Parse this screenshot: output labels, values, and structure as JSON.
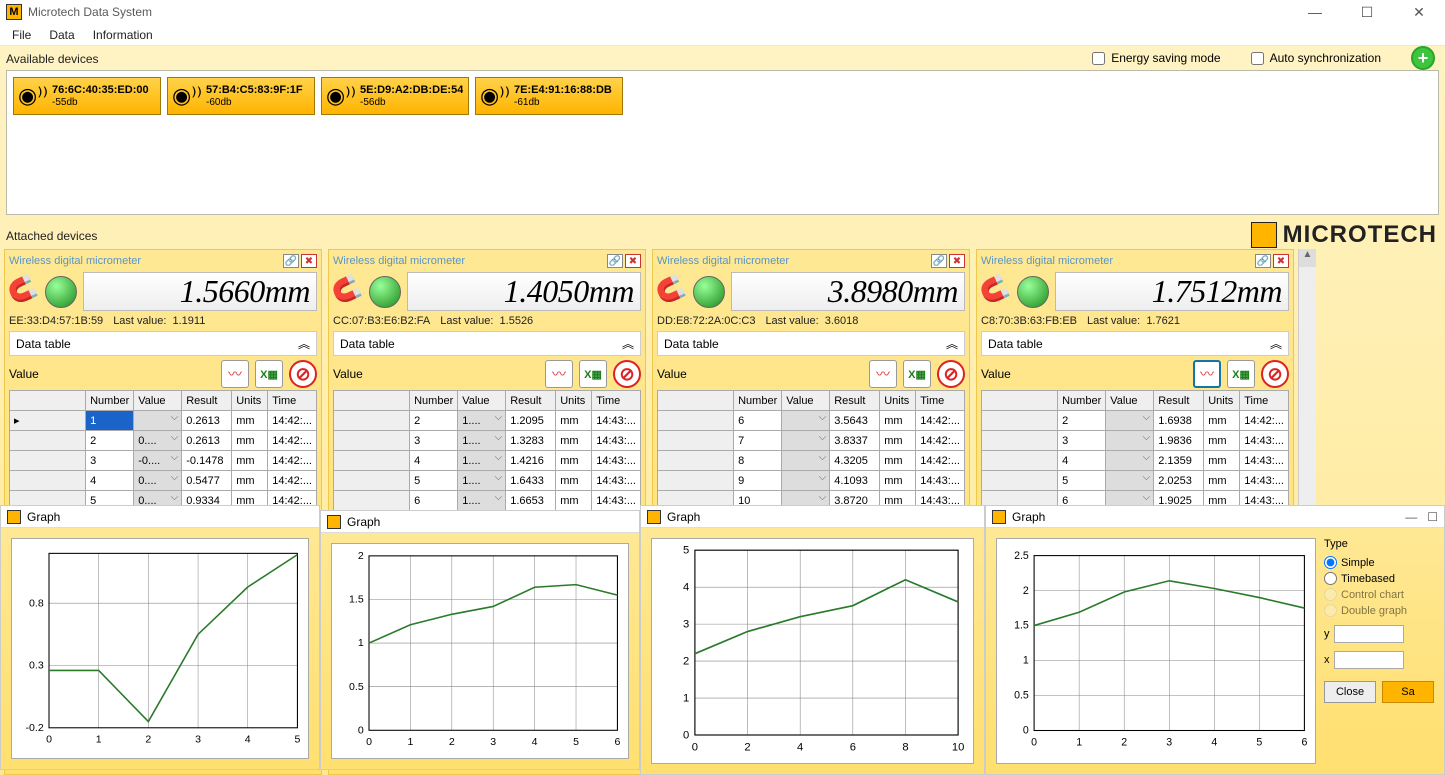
{
  "window": {
    "title": "Microtech Data System"
  },
  "menu": {
    "file": "File",
    "data": "Data",
    "info": "Information"
  },
  "labels": {
    "available": "Available devices",
    "attached": "Attached devices",
    "energy": "Energy saving mode",
    "autosync": "Auto synchronization",
    "brand": "MICROTECH",
    "data_table": "Data table",
    "value": "Value",
    "graph": "Graph",
    "type": "Type",
    "simple": "Simple",
    "timebased": "Timebased",
    "control": "Control chart",
    "double": "Double graph",
    "y": "y",
    "x": "x",
    "close": "Close",
    "save": "Save",
    "last_value": "Last value:"
  },
  "available_devices": [
    {
      "mac": "76:6C:40:35:ED:00",
      "db": "-55db"
    },
    {
      "mac": "57:B4:C5:83:9F:1F",
      "db": "-60db"
    },
    {
      "mac": "5E:D9:A2:DB:DE:54",
      "db": "-56db"
    },
    {
      "mac": "7E:E4:91:16:88:DB",
      "db": "-61db"
    }
  ],
  "columns": {
    "number": "Number",
    "value": "Value",
    "result": "Result",
    "units": "Units",
    "time": "Time"
  },
  "panels": [
    {
      "title": "Wireless digital micrometer",
      "reading": "1.5660mm",
      "id": "EE:33:D4:57:1B:59",
      "last": "1.1911",
      "highlight": 0,
      "rows": [
        {
          "n": "1",
          "v": "",
          "r": "0.2613",
          "u": "mm",
          "t": "14:42:..."
        },
        {
          "n": "2",
          "v": "0....",
          "r": "0.2613",
          "u": "mm",
          "t": "14:42:..."
        },
        {
          "n": "3",
          "v": "-0....",
          "r": "-0.1478",
          "u": "mm",
          "t": "14:42:..."
        },
        {
          "n": "4",
          "v": "0....",
          "r": "0.5477",
          "u": "mm",
          "t": "14:42:..."
        },
        {
          "n": "5",
          "v": "0....",
          "r": "0.9334",
          "u": "mm",
          "t": "14:42:..."
        }
      ]
    },
    {
      "title": "Wireless digital micrometer",
      "reading": "1.4050mm",
      "id": "CC:07:B3:E6:B2:FA",
      "last": "1.5526",
      "rows": [
        {
          "n": "2",
          "v": "1....",
          "r": "1.2095",
          "u": "mm",
          "t": "14:43:..."
        },
        {
          "n": "3",
          "v": "1....",
          "r": "1.3283",
          "u": "mm",
          "t": "14:43:..."
        },
        {
          "n": "4",
          "v": "1....",
          "r": "1.4216",
          "u": "mm",
          "t": "14:43:..."
        },
        {
          "n": "5",
          "v": "1....",
          "r": "1.6433",
          "u": "mm",
          "t": "14:43:..."
        },
        {
          "n": "6",
          "v": "1....",
          "r": "1.6653",
          "u": "mm",
          "t": "14:43:..."
        }
      ]
    },
    {
      "title": "Wireless digital micrometer",
      "reading": "3.8980mm",
      "id": "DD:E8:72:2A:0C:C3",
      "last": "3.6018",
      "rows": [
        {
          "n": "6",
          "v": "",
          "r": "3.5643",
          "u": "mm",
          "t": "14:42:..."
        },
        {
          "n": "7",
          "v": "",
          "r": "3.8337",
          "u": "mm",
          "t": "14:42:..."
        },
        {
          "n": "8",
          "v": "",
          "r": "4.3205",
          "u": "mm",
          "t": "14:42:..."
        },
        {
          "n": "9",
          "v": "",
          "r": "4.1093",
          "u": "mm",
          "t": "14:43:..."
        },
        {
          "n": "10",
          "v": "",
          "r": "3.8720",
          "u": "mm",
          "t": "14:43:..."
        }
      ]
    },
    {
      "title": "Wireless digital micrometer",
      "reading": "1.7512mm",
      "id": "C8:70:3B:63:FB:EB",
      "last": "1.7621",
      "rows": [
        {
          "n": "2",
          "v": "",
          "r": "1.6938",
          "u": "mm",
          "t": "14:42:..."
        },
        {
          "n": "3",
          "v": "",
          "r": "1.9836",
          "u": "mm",
          "t": "14:43:..."
        },
        {
          "n": "4",
          "v": "",
          "r": "2.1359",
          "u": "mm",
          "t": "14:43:..."
        },
        {
          "n": "5",
          "v": "",
          "r": "2.0253",
          "u": "mm",
          "t": "14:43:..."
        },
        {
          "n": "6",
          "v": "",
          "r": "1.9025",
          "u": "mm",
          "t": "14:43:..."
        }
      ]
    }
  ],
  "chart_data": [
    {
      "type": "line",
      "title": "Graph",
      "xlabel": "",
      "ylabel": "",
      "x": [
        0,
        1,
        2,
        3,
        4,
        5
      ],
      "values": [
        0.26,
        0.26,
        -0.15,
        0.55,
        0.93,
        1.19
      ],
      "ylim": [
        -0.2,
        1.2
      ],
      "xlim": [
        0,
        5
      ]
    },
    {
      "type": "line",
      "title": "Graph",
      "xlabel": "",
      "ylabel": "",
      "x": [
        0,
        1,
        2,
        3,
        4,
        5,
        6
      ],
      "values": [
        1.0,
        1.21,
        1.33,
        1.42,
        1.64,
        1.67,
        1.55
      ],
      "ylim": [
        0,
        2
      ],
      "xlim": [
        0,
        6
      ]
    },
    {
      "type": "line",
      "title": "Graph",
      "xlabel": "",
      "ylabel": "",
      "x": [
        0,
        2,
        4,
        6,
        8,
        10
      ],
      "values": [
        2.2,
        2.8,
        3.2,
        3.5,
        4.2,
        3.6
      ],
      "ylim": [
        0,
        5
      ],
      "xlim": [
        0,
        10
      ]
    },
    {
      "type": "line",
      "title": "Graph",
      "xlabel": "",
      "ylabel": "",
      "x": [
        0,
        1,
        2,
        3,
        4,
        5,
        6
      ],
      "values": [
        1.5,
        1.69,
        1.98,
        2.14,
        2.03,
        1.9,
        1.75
      ],
      "ylim": [
        0,
        2.5
      ],
      "xlim": [
        0,
        6
      ]
    }
  ]
}
